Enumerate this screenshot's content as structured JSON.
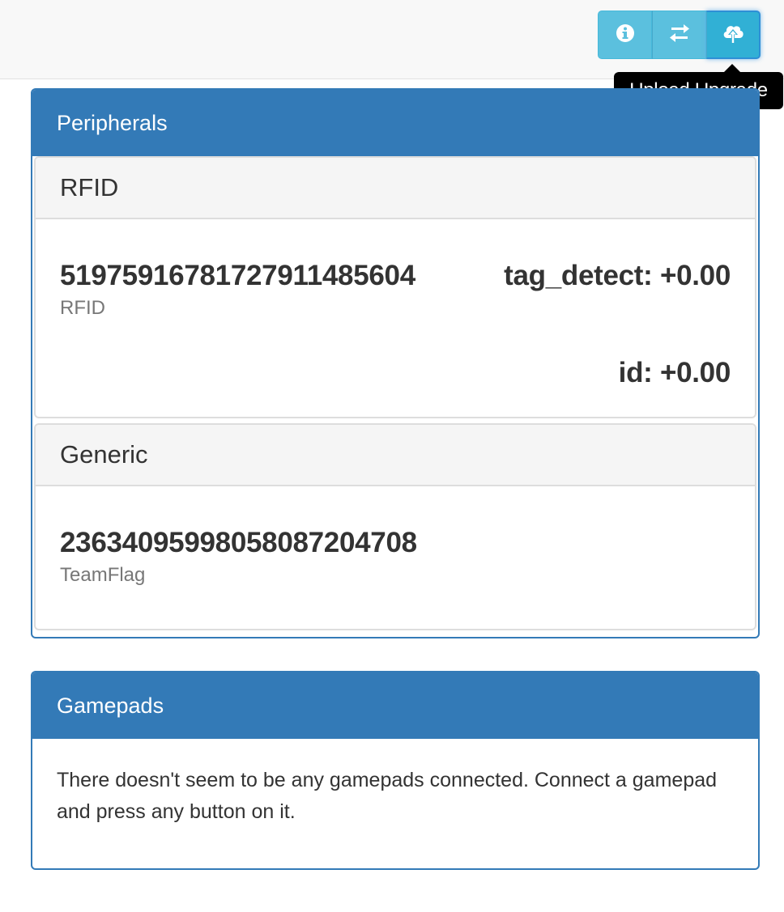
{
  "toolbar": {
    "buttons": [
      {
        "icon": "info-icon"
      },
      {
        "icon": "swap-arrows-icon"
      },
      {
        "icon": "cloud-upload-icon"
      }
    ],
    "tooltip": "Upload Upgrade",
    "colors": {
      "button": "#5bc0de",
      "active_button": "#31b0d5",
      "tooltip_bg": "#000000"
    }
  },
  "peripherals": {
    "title": "Peripherals",
    "groups": [
      {
        "heading": "RFID",
        "devices": [
          {
            "name": "5197591678172791​1485604",
            "type": "RFID",
            "readings": [
              "tag_detect: +0.00",
              "id: +0.00"
            ]
          }
        ]
      },
      {
        "heading": "Generic",
        "devices": [
          {
            "name": "2363409599805808​7204708",
            "type": "TeamFlag",
            "readings": []
          }
        ]
      }
    ],
    "colors": {
      "header": "#337ab7",
      "sub_header": "#f5f5f5"
    }
  },
  "gamepads": {
    "title": "Gamepads",
    "message": "There doesn't seem to be any gamepads connected. Connect a gamepad and press any button on it."
  }
}
